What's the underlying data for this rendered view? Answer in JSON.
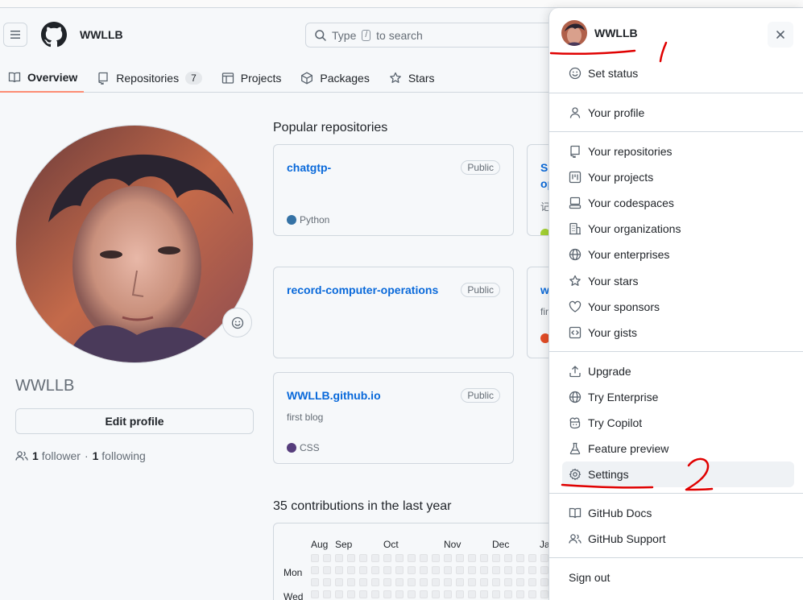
{
  "header": {
    "username": "WWLLB",
    "search_prefix": "Type",
    "search_key": "/",
    "search_suffix": "to search"
  },
  "tabs": [
    {
      "label": "Overview",
      "icon": "book-icon"
    },
    {
      "label": "Repositories",
      "icon": "repo-icon",
      "count": "7"
    },
    {
      "label": "Projects",
      "icon": "table-icon"
    },
    {
      "label": "Packages",
      "icon": "package-icon"
    },
    {
      "label": "Stars",
      "icon": "star-icon"
    }
  ],
  "profile": {
    "login": "WWLLB",
    "edit_label": "Edit profile",
    "followers_count": "1",
    "followers_label": "follower",
    "separator": "·",
    "following_count": "1",
    "following_label": "following"
  },
  "popular": {
    "title": "Popular repositories",
    "repos": [
      {
        "name": "chatgtp-",
        "visibility": "Public",
        "description": "",
        "language": "Python",
        "lang_color": "#3572A5"
      },
      {
        "name": "record-computer-operations",
        "visibility": "Public",
        "description": "",
        "language": "",
        "lang_color": ""
      },
      {
        "name": "WWLLB.github.io",
        "visibility": "Public",
        "description": "first blog",
        "language": "CSS",
        "lang_color": "#563d7c"
      }
    ],
    "clipped": [
      {
        "line1": "Sc",
        "line2": "op",
        "desc": "记",
        "dot_color": "#a4d233"
      },
      {
        "line1": "w",
        "line2": "",
        "desc": "fir",
        "dot_color": "#e34c26"
      }
    ]
  },
  "contributions": {
    "title": "35 contributions in the last year",
    "months": [
      "Aug",
      "Sep",
      "Oct",
      "Nov",
      "Dec",
      "Ja"
    ],
    "days": [
      "Mon",
      "Wed"
    ]
  },
  "dropdown": {
    "username": "WWLLB",
    "groups": [
      [
        {
          "label": "Set status",
          "icon": "smiley-icon"
        }
      ],
      [
        {
          "label": "Your profile",
          "icon": "person-icon"
        }
      ],
      [
        {
          "label": "Your repositories",
          "icon": "repo-icon"
        },
        {
          "label": "Your projects",
          "icon": "project-icon"
        },
        {
          "label": "Your codespaces",
          "icon": "codespaces-icon"
        },
        {
          "label": "Your organizations",
          "icon": "organization-icon"
        },
        {
          "label": "Your enterprises",
          "icon": "globe-icon"
        },
        {
          "label": "Your stars",
          "icon": "star-icon"
        },
        {
          "label": "Your sponsors",
          "icon": "heart-icon"
        },
        {
          "label": "Your gists",
          "icon": "code-square-icon"
        }
      ],
      [
        {
          "label": "Upgrade",
          "icon": "upload-icon"
        },
        {
          "label": "Try Enterprise",
          "icon": "globe-icon"
        },
        {
          "label": "Try Copilot",
          "icon": "copilot-icon"
        },
        {
          "label": "Feature preview",
          "icon": "beaker-icon"
        },
        {
          "label": "Settings",
          "icon": "gear-icon"
        }
      ],
      [
        {
          "label": "GitHub Docs",
          "icon": "book-icon"
        },
        {
          "label": "GitHub Support",
          "icon": "people-icon"
        }
      ],
      [
        {
          "label": "Sign out",
          "icon": ""
        }
      ]
    ]
  },
  "annotations": {
    "mark_1": "1",
    "mark_2": "2",
    "color": "#e00000"
  }
}
